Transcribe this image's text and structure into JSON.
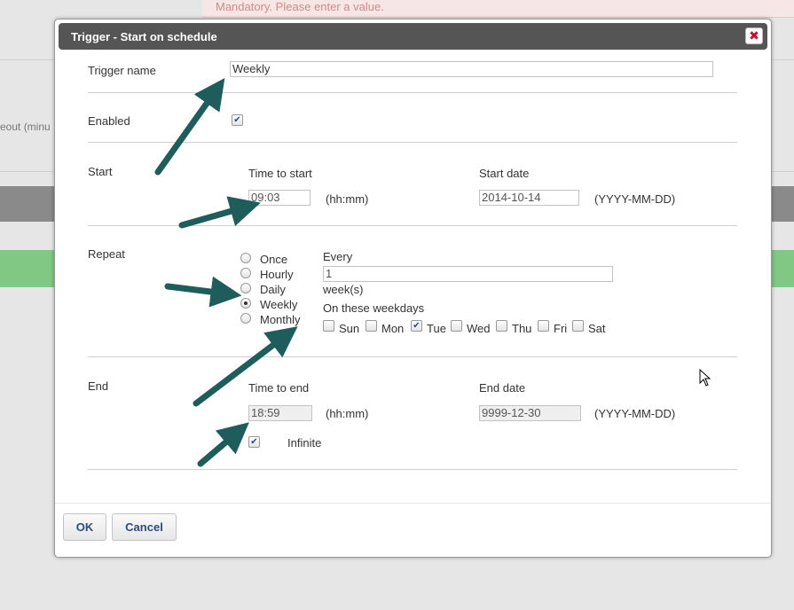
{
  "background": {
    "error_text": "Mandatory. Please enter a value.",
    "timeout_label": "eout (minu"
  },
  "dialog": {
    "title": "Trigger - Start on schedule",
    "close_icon": "close-icon"
  },
  "trigger_name": {
    "label": "Trigger name",
    "value": "Weekly"
  },
  "enabled": {
    "label": "Enabled",
    "checked": true
  },
  "start": {
    "label": "Start",
    "time_label": "Time to start",
    "time_value": "09:03",
    "time_format": "(hh:mm)",
    "date_label": "Start date",
    "date_value": "2014-10-14",
    "date_format": "(YYYY-MM-DD)"
  },
  "repeat": {
    "label": "Repeat",
    "options": [
      "Once",
      "Hourly",
      "Daily",
      "Weekly",
      "Monthly"
    ],
    "selected": "Weekly",
    "every_label": "Every",
    "every_value": "1",
    "unit": "week(s)",
    "weekdays_label": "On these weekdays",
    "weekdays": [
      {
        "label": "Sun",
        "checked": false
      },
      {
        "label": "Mon",
        "checked": false
      },
      {
        "label": "Tue",
        "checked": true
      },
      {
        "label": "Wed",
        "checked": false
      },
      {
        "label": "Thu",
        "checked": false
      },
      {
        "label": "Fri",
        "checked": false
      },
      {
        "label": "Sat",
        "checked": false
      }
    ]
  },
  "end": {
    "label": "End",
    "time_label": "Time to end",
    "time_value": "18:59",
    "time_format": "(hh:mm)",
    "date_label": "End date",
    "date_value": "9999-12-30",
    "date_format": "(YYYY-MM-DD)",
    "infinite_label": "Infinite",
    "infinite_checked": true
  },
  "buttons": {
    "ok": "OK",
    "cancel": "Cancel"
  },
  "colors": {
    "titlebar": "#555555",
    "arrow": "#1f5c5c",
    "button_text": "#2b4c7c",
    "close": "#c8102e"
  }
}
